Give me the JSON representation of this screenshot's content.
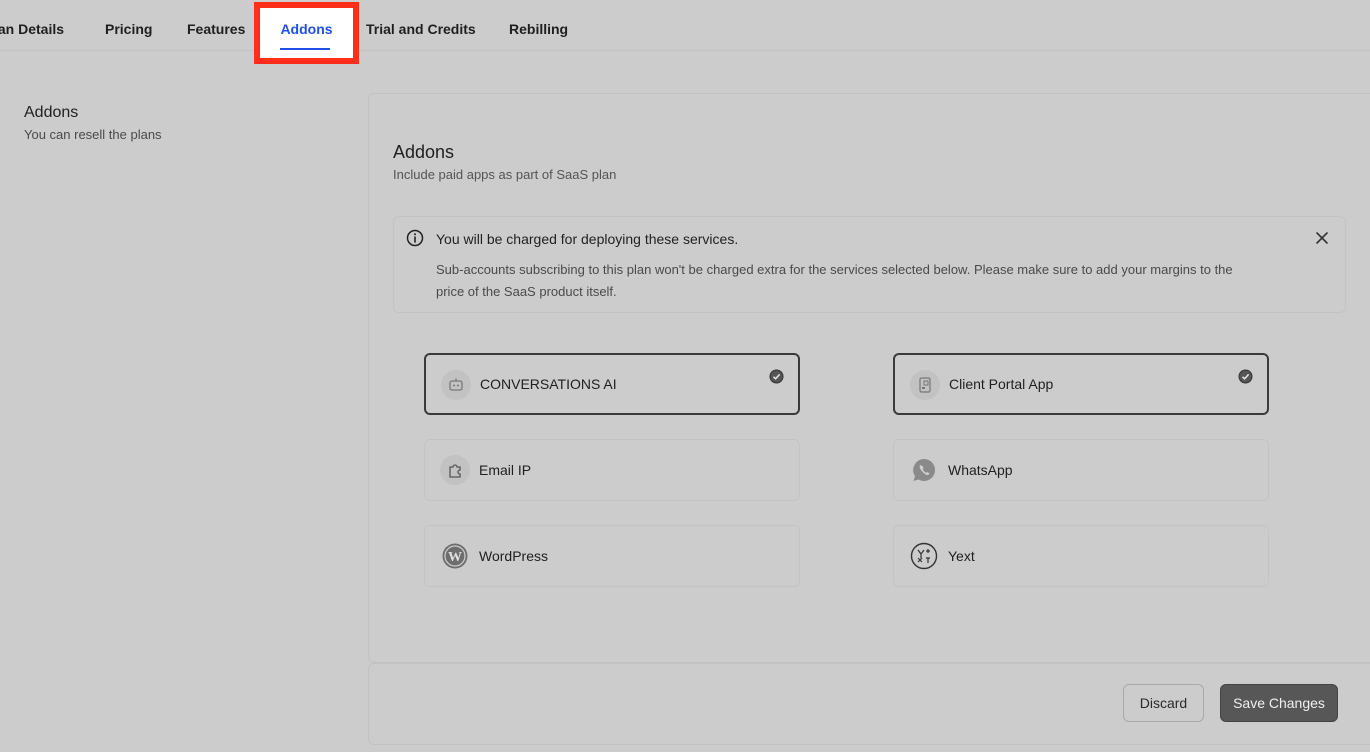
{
  "tabs": {
    "plan_details": "lan Details",
    "pricing": "Pricing",
    "features": "Features",
    "addons": "Addons",
    "trial": "Trial and Credits",
    "rebilling": "Rebilling"
  },
  "left": {
    "title": "Addons",
    "subtitle": "You can resell the plans"
  },
  "card": {
    "title": "Addons",
    "subtitle": "Include paid apps as part of SaaS plan"
  },
  "alert": {
    "title": "You will be charged for deploying these services.",
    "body": "Sub-accounts subscribing to this plan won't be charged extra for the services selected below. Please make sure to add your margins to the price of the SaaS product itself."
  },
  "addons": [
    {
      "label": "CONVERSATIONS AI",
      "icon": "robot-icon",
      "selected": true
    },
    {
      "label": "Client Portal App",
      "icon": "mobile-qr-icon",
      "selected": true
    },
    {
      "label": "Email IP",
      "icon": "puzzle-icon",
      "selected": false
    },
    {
      "label": "WhatsApp",
      "icon": "whatsapp-icon",
      "selected": false
    },
    {
      "label": "WordPress",
      "icon": "wordpress-icon",
      "selected": false
    },
    {
      "label": "Yext",
      "icon": "yext-icon",
      "selected": false
    }
  ],
  "footer": {
    "discard_label": "Discard",
    "save_label": "Save Changes"
  },
  "colors": {
    "accent": "#2050e8",
    "highlight": "#ff2d1a",
    "background": "#cccccc",
    "primary_button": "#575757"
  }
}
